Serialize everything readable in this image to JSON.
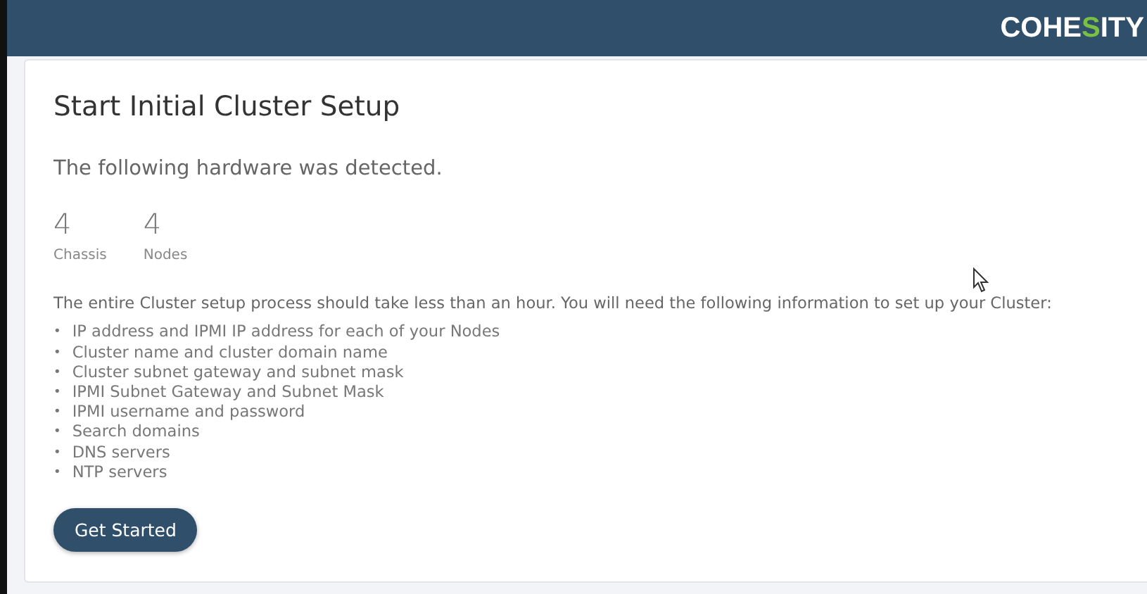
{
  "header": {
    "logo": [
      {
        "text": "COHE",
        "accent": false
      },
      {
        "text": "S",
        "accent": true
      },
      {
        "text": "ITY",
        "accent": false
      }
    ]
  },
  "card": {
    "title": "Start Initial Cluster Setup",
    "subtitle": "The following hardware was detected.",
    "stats": [
      {
        "value": "4",
        "label": "Chassis"
      },
      {
        "value": "4",
        "label": "Nodes"
      }
    ],
    "intro": "The entire Cluster setup process should take less than an hour. You will need the following information to set up your Cluster:",
    "bullet": "•",
    "requirements": [
      "IP address and IPMI IP address for each of your Nodes",
      "Cluster name and cluster domain name",
      "Cluster subnet gateway and subnet mask",
      "IPMI Subnet Gateway and Subnet Mask",
      "IPMI username and password",
      "Search domains",
      "DNS servers",
      "NTP servers"
    ],
    "button": "Get Started"
  }
}
